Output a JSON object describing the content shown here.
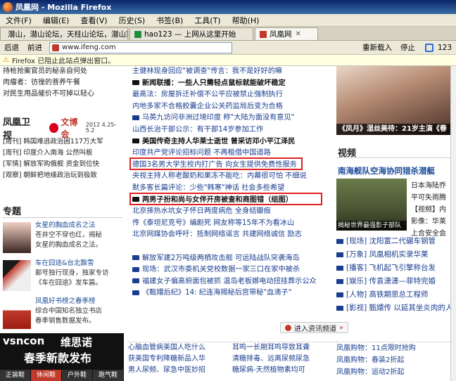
{
  "window": {
    "title": "凤凰网 - Mozilla Firefox"
  },
  "menu": [
    "文件(F)",
    "编辑(E)",
    "查看(V)",
    "历史(S)",
    "书签(B)",
    "工具(T)",
    "帮助(H)"
  ],
  "tabs": [
    {
      "label": "潜山，潜山论坛，天柱山论坛，潜山家…",
      "active": false
    },
    {
      "label": "hao123 — 上网从这里开始",
      "active": false
    },
    {
      "label": "凤凰网",
      "active": true
    }
  ],
  "nav": {
    "back": "后退",
    "forward": "前进",
    "url": "www.ifeng.com",
    "reload": "重新载入",
    "stop": "停止",
    "badge": "123"
  },
  "notice": "Firefox 已阻止此站点弹出窗口。",
  "left_top_lines": [
    "持枪抢案官员的秘亲自何处",
    "肉瘤者：彷徨的菩养午餐",
    "对民生用品催价不可掉以轻心"
  ],
  "weishi": {
    "title": "凤凰卫视",
    "expo_name": "文博会",
    "expo_date": "2012 4.25-5.2",
    "items": [
      "[周刊] 韩国难逃政治困117万大军",
      "[周刊] 印度介入南海 公然叫板",
      "[军情] 解放军购俄舰 资金到位快",
      "[观察] 朝鲜把地缘政治玩到极致"
    ]
  },
  "zhuanti": {
    "title": "专题",
    "features": [
      {
        "lines": [
          "女星的胸血成名之法",
          "苍井空不穿也红，揭秘",
          "女星的胸血成名之法。"
        ]
      },
      {
        "lines": [
          "车在囧途&台北飘雪",
          "鄙号独行现身，独家专访",
          "《车在囧途》发车篇。"
        ]
      },
      {
        "lines": [
          "凤凰好书榜之春季榜",
          "综合中国知名独立书店",
          "春季销售数据发布。"
        ]
      }
    ]
  },
  "ad": {
    "brand": "vsncon",
    "brand_cn": "维思诺",
    "slogan": "春季新款发布",
    "cats": [
      "正装鞋",
      "休闲鞋",
      "户外鞋",
      "跑气鞋"
    ]
  },
  "news": [
    {
      "text": "主健林现身回应\"被调查\"传言：我不是好好的嘛",
      "bold": false,
      "cam": false
    },
    {
      "text": "新闻联播：一些人只需轻点鼠标就能破坏稳定",
      "bold": true,
      "cam": true
    },
    {
      "text": "最高法：房屋拆迁补偿不公平应被禁止强制执行",
      "bold": false,
      "cam": false
    },
    {
      "text": "内地多家不合格胶囊企业公关药监局后变为合格",
      "bold": false,
      "cam": false
    },
    {
      "text": "马英九访问非洲过境印度 称\"大陆为面没有意见\"",
      "bold": false,
      "cam": true
    },
    {
      "text": "山西长治干部公示：有干部14岁参加工作",
      "bold": false,
      "cam": false
    },
    {
      "text": "美国传奇主持人华莱士逝世 曾采访邓小平江泽民",
      "bold": true,
      "cam": true
    },
    {
      "text": "印度共产党评论招标问题 不再租借中国道路",
      "bold": false,
      "cam": false
    },
    {
      "text": "德国3名男大学生校内打广告 向女生提供免费性服务",
      "bold": false,
      "cam": false
    },
    {
      "text": "央视主持人称老酸奶和果冻不能吃：内幕很可怕 不细说",
      "bold": false,
      "cam": false
    },
    {
      "text": "默多客长篇评论：少些\"韩寒\"神话 社会多些希望",
      "bold": false,
      "cam": false
    },
    {
      "text": "两男子扮和尚与女伴开房被查和商图错（组图）",
      "bold": true,
      "cam": true
    },
    {
      "text": "北京摔热水坑女子怀日两度病危 全身结瓣痂",
      "bold": false,
      "cam": false
    },
    {
      "text": "传《泰坦尼克号》编剧死 网友称等15年不为看冰山",
      "bold": false,
      "cam": false
    },
    {
      "text": "北京网媒协会呼吁：抵制网络谣言 共建网络诚信 励志",
      "bold": false,
      "cam": false
    },
    {
      "text": "",
      "bold": false,
      "cam": false
    },
    {
      "text": "解放军建2万吨级两栖攻击舰 可运陆战队突袭海岛",
      "bold": false,
      "cam": true
    },
    {
      "text": "现场：武汉市委机关党校数据一家三口在家中被杀",
      "bold": false,
      "cam": true
    },
    {
      "text": "福建女子偏高俯面包被抓 温岛老板娜电动扭挂葬示公众",
      "bold": false,
      "cam": true
    },
    {
      "text": "《甄嬛后纪》14: 纪连海揭秘后宫带秘\"血滴子\"",
      "bold": false,
      "cam": true
    }
  ],
  "more_button": "进入资讯频道",
  "bottom_mid": [
    [
      "心脑血管病美国人吃什么",
      "耳鸣一长期耳鸣导致耳聋"
    ],
    [
      "获美国专利降糖新品入华",
      "清糖排毒、远离尿频尿急"
    ],
    [
      "男人尿频、尿急中医妙招",
      "糖尿病-天然植物素均可"
    ]
  ],
  "right": {
    "photo_caption": "《凤月》湿丝美待：21岁主演《春",
    "video_title": "视频",
    "video_headline": "南海舰队空海协同猎杀潜艇",
    "video_caption": "揭秘世界最强影子部队",
    "video_side": [
      "日本海陆乔",
      "平可失雨腾",
      "【视频】内",
      "影像：华莱",
      "上合安全会"
    ],
    "video_list": [
      "[现场] 沈阳富二代碾车钢管",
      "[万象] 凤凰相机实录华莱",
      "[播客] 飞机起飞引擎称台发",
      "[娱乐] 传袁潇潇—菲特完婚",
      "[人物] 高铁期思总工程师",
      "[影视] 甄嬛传 以延其坐炎肉的人"
    ],
    "shop": [
      "凤凰购物：11点限时抢购",
      "凤凰购物：春装2折起",
      "凤凰购物：运动2折起"
    ]
  }
}
